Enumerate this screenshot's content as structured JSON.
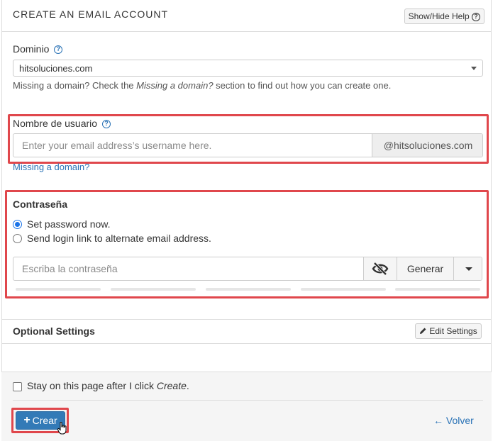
{
  "header": {
    "title": "CREATE AN EMAIL ACCOUNT",
    "help_button": "Show/Hide Help"
  },
  "domain": {
    "label": "Dominio",
    "selected": "hitsoluciones.com",
    "help_prefix": "Missing a domain? Check the ",
    "help_em": "Missing a domain?",
    "help_suffix": " section to find out how you can create one."
  },
  "username": {
    "label": "Nombre de usuario",
    "placeholder": "Enter your email address’s username here.",
    "suffix": "@hitsoluciones.com",
    "missing_link": "Missing a domain?"
  },
  "password": {
    "label": "Contraseña",
    "options": [
      "Set password now.",
      "Send login link to alternate email address."
    ],
    "selected_option": 0,
    "placeholder": "Escriba la contraseña",
    "generate_label": "Generar",
    "strength_segments": 5
  },
  "optional": {
    "title": "Optional Settings",
    "edit_button": "Edit Settings"
  },
  "footer": {
    "stay_prefix": "Stay on this page after I click ",
    "stay_em": "Create",
    "stay_suffix": ".",
    "create_button": "Crear",
    "back_link": "Volver"
  },
  "colors": {
    "accent": "#337ab7",
    "link": "#2b73b6",
    "highlight": "#e0474c",
    "radio_checked": "#1a73e8"
  }
}
